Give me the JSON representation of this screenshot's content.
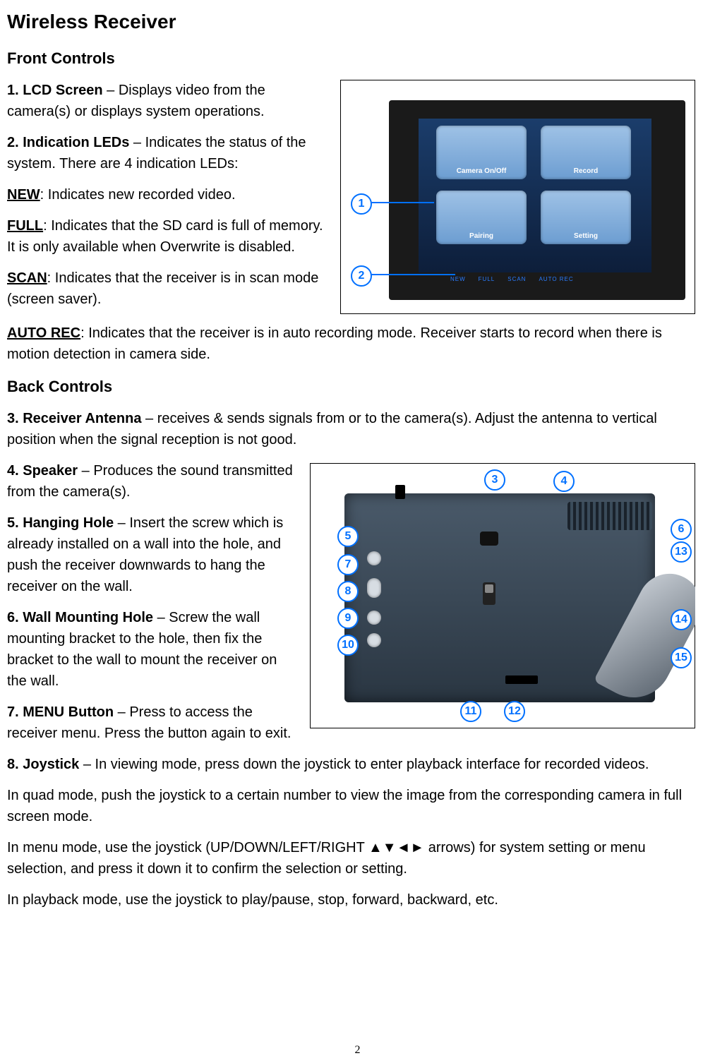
{
  "title": "Wireless Receiver",
  "section_front": "Front Controls",
  "section_back": "Back Controls",
  "items": {
    "lcd_label": "1. LCD Screen",
    "lcd_text": " – Displays video from the camera(s) or displays system operations.",
    "led_label": "2. Indication LEDs",
    "led_text": " – Indicates the status of the system. There are 4 indication LEDs:",
    "new_label": "NEW",
    "new_text": ": Indicates new recorded video.",
    "full_label": "FULL",
    "full_text": ": Indicates that the SD card is full of memory. It is only available when Overwrite is disabled.",
    "scan_label": "SCAN",
    "scan_text": ": Indicates that the receiver is in scan mode (screen saver).",
    "autorec_label": "AUTO REC",
    "autorec_text": ": Indicates that the receiver is in auto recording mode. Receiver starts to record when there is motion detection in camera side.",
    "ant_label": "3. Receiver Antenna",
    "ant_text": " – receives & sends signals from or to the camera(s). Adjust the antenna to vertical position when the signal reception is not good.",
    "spk_label": "4. Speaker",
    "spk_text": " – Produces the sound transmitted from the camera(s).",
    "hang_label": "5. Hanging Hole",
    "hang_text": " – Insert the screw which is already installed on a wall into the hole, and push the receiver downwards to hang the receiver on the wall.",
    "wall_label": "6. Wall Mounting Hole",
    "wall_text": " – Screw the wall mounting bracket to the hole, then fix the bracket to the wall to mount the receiver on the wall.",
    "menu_label": "7. MENU Button",
    "menu_text": " – Press to access the receiver menu. Press the button again to exit.",
    "joy_label": "8. Joystick",
    "joy_text": " – In viewing mode, press down the joystick to enter playback interface for recorded videos.",
    "joy_p2": "In quad mode, push the joystick to a certain number to view the image from the corresponding camera in full screen mode.",
    "joy_p3": "In menu mode, use the joystick (UP/DOWN/LEFT/RIGHT ▲▼◄► arrows) for system setting or menu selection, and press it down it to confirm the selection or setting.",
    "joy_p4": "In playback mode, use the joystick to play/pause, stop, forward, backward, etc."
  },
  "figure1": {
    "callouts": {
      "c1": "1",
      "c2": "2"
    },
    "menu": {
      "m1": "Camera On/Off",
      "m2": "Record",
      "m3": "Pairing",
      "m4": "Setting"
    },
    "leds": [
      "NEW",
      "FULL",
      "SCAN",
      "AUTO REC"
    ]
  },
  "figure2": {
    "callouts": {
      "c3": "3",
      "c4": "4",
      "c5": "5",
      "c6": "6",
      "c7": "7",
      "c8": "8",
      "c9": "9",
      "c10": "10",
      "c11": "11",
      "c12": "12",
      "c13": "13",
      "c14": "14",
      "c15": "15"
    }
  },
  "page_number": "2"
}
